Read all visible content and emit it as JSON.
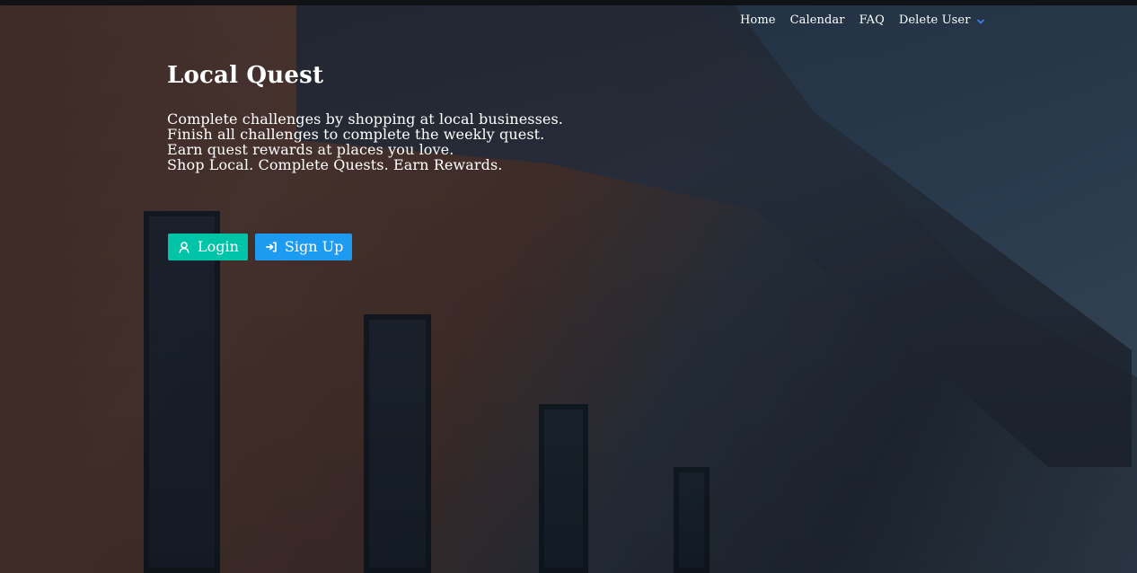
{
  "nav": {
    "items": [
      {
        "label": "Home"
      },
      {
        "label": "Calendar"
      },
      {
        "label": "FAQ"
      },
      {
        "label": "Delete User",
        "icon": "chevron-down-icon"
      }
    ]
  },
  "hero": {
    "title": "Local Quest",
    "lines": [
      "Complete challenges by shopping at local businesses.",
      "Finish all challenges to complete the weekly quest.",
      "Earn quest rewards at places you love.",
      "Shop Local. Complete Quests. Earn Rewards."
    ],
    "buttons": {
      "login": {
        "label": "Login",
        "icon": "user-icon",
        "color": "#00c4a7"
      },
      "signup": {
        "label": "Sign Up",
        "icon": "sign-in-icon",
        "color": "#1d9bf0"
      }
    }
  },
  "colors": {
    "accent_chevron": "#3b82f6"
  }
}
